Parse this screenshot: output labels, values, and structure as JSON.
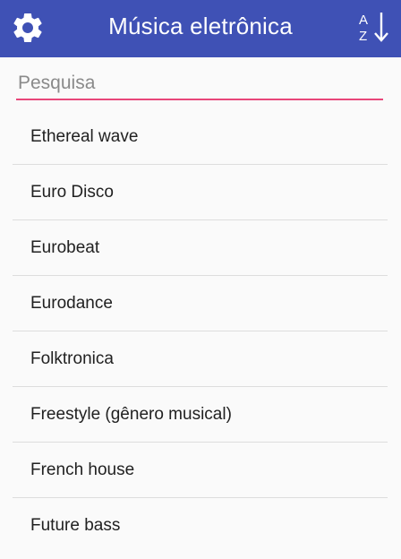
{
  "toolbar": {
    "title": "Música eletrônica",
    "settings_icon": "gear-icon",
    "sort_icon": "sort-az-icon",
    "background_color": "#3f51b5"
  },
  "search": {
    "placeholder": "Pesquisa",
    "value": "",
    "underline_color": "#e8467a"
  },
  "list": {
    "items": [
      "Ethereal wave",
      "Euro Disco",
      "Eurobeat",
      "Eurodance",
      "Folktronica",
      "Freestyle (gênero musical)",
      "French house",
      "Future bass"
    ]
  }
}
